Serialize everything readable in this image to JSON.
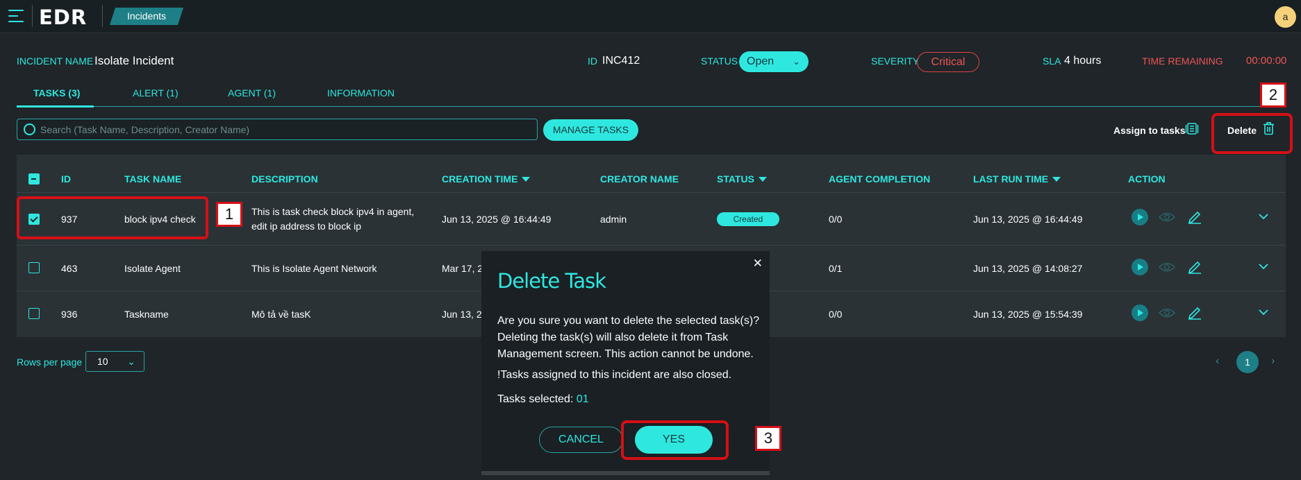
{
  "app": {
    "name": "EDR",
    "breadcrumb": "Incidents",
    "user_initial": "a"
  },
  "incident": {
    "name_label": "INCIDENT NAME",
    "name": "Isolate Incident",
    "id_label": "ID",
    "id": "INC412",
    "status_label": "STATUS",
    "status": "Open",
    "severity_label": "SEVERITY",
    "severity": "Critical",
    "sla_label": "SLA",
    "sla": "4 hours",
    "time_label": "TIME REMAINING",
    "time": "00:00:00"
  },
  "tabs": [
    "TASKS (3)",
    "ALERT (1)",
    "AGENT (1)",
    "INFORMATION"
  ],
  "toolbar": {
    "search_placeholder": "Search (Task Name, Description, Creator Name)",
    "manage_tasks": "MANAGE TASKS",
    "assign": "Assign to tasks",
    "delete": "Delete"
  },
  "table": {
    "headers": [
      "ID",
      "TASK NAME",
      "DESCRIPTION",
      "CREATION TIME",
      "CREATOR NAME",
      "STATUS",
      "AGENT COMPLETION",
      "LAST RUN TIME",
      "ACTION"
    ],
    "rows": [
      {
        "id": "937",
        "name": "block ipv4 check",
        "desc1": "This is task check block ipv4 in agent,",
        "desc2": "edit ip address to block ip",
        "created": "Jun 13, 2025 @ 16:44:49",
        "creator": "admin",
        "status": "Created",
        "completion": "0/0",
        "last_run": "Jun 13, 2025 @ 16:44:49",
        "checked": true
      },
      {
        "id": "463",
        "name": "Isolate Agent",
        "desc1": "This is Isolate Agent Network",
        "created": "Mar 17, 2",
        "completion": "0/1",
        "last_run": "Jun 13, 2025 @ 14:08:27",
        "checked": false
      },
      {
        "id": "936",
        "name": "Taskname",
        "desc1": "Mô tả về tasK",
        "created": "Jun 13, 20",
        "completion": "0/0",
        "last_run": "Jun 13, 2025 @ 15:54:39",
        "checked": false
      }
    ]
  },
  "pagination": {
    "rows_label": "Rows per page",
    "rows_value": "10",
    "current": "1"
  },
  "modal": {
    "title": "Delete Task",
    "body": "Are you sure you want to delete the selected task(s)? Deleting the task(s) will also delete it from Task Management screen. This action cannot be undone.",
    "warning": "!Tasks assigned to this incident are also closed.",
    "selected_label": "Tasks selected:",
    "selected_count": "01",
    "cancel": "CANCEL",
    "yes": "YES"
  },
  "callouts": [
    "1",
    "2",
    "3"
  ],
  "colors": {
    "accent": "#2ee8e0",
    "callout": "#d51016",
    "danger": "#ee5555"
  }
}
